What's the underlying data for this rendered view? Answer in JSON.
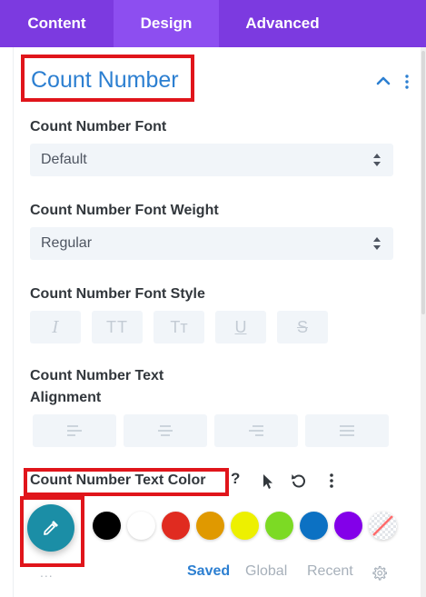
{
  "tabs": [
    {
      "label": "Content"
    },
    {
      "label": "Design",
      "active": true
    },
    {
      "label": "Advanced"
    }
  ],
  "section": {
    "title": "Count Number",
    "icons": {
      "collapse": "chevron-up-icon",
      "more": "vertical-dots-icon"
    }
  },
  "fields": {
    "font": {
      "label": "Count Number Font",
      "value": "Default"
    },
    "weight": {
      "label": "Count Number Font Weight",
      "value": "Regular"
    },
    "style": {
      "label": "Count Number Font Style",
      "buttons": [
        {
          "glyph": "I",
          "icon": "italic-icon"
        },
        {
          "glyph": "TT",
          "icon": "uppercase-icon"
        },
        {
          "glyph": "Tт",
          "icon": "capitalize-icon"
        },
        {
          "glyph": "U",
          "icon": "underline-icon"
        },
        {
          "glyph": "S",
          "icon": "strikethrough-icon"
        }
      ]
    },
    "alignment": {
      "label": "Count Number Text Alignment",
      "buttons": [
        "align-left-icon",
        "align-center-icon",
        "align-right-icon",
        "align-justify-icon"
      ]
    },
    "color": {
      "label": "Count Number Text Color",
      "help": "?",
      "icons": [
        "help-icon",
        "cursor-hover-icon",
        "reset-icon",
        "vertical-dots-icon"
      ],
      "picker_icon": "eyedropper-icon",
      "picker_color": "#1b8ea6",
      "swatches": [
        "#000000",
        "#ffffff",
        "#e02b20",
        "#e09900",
        "#edf000",
        "#7cda24",
        "#0c71c3",
        "#8300e9"
      ],
      "more": "...",
      "palette_tabs": [
        "Saved",
        "Global",
        "Recent"
      ],
      "active_palette_tab": "Saved"
    }
  },
  "colors": {
    "tab_bar": "#7c3ae0",
    "tab_active": "#8d4ef0",
    "accent": "#2c7fd1",
    "highlight_box": "#e0151b"
  }
}
